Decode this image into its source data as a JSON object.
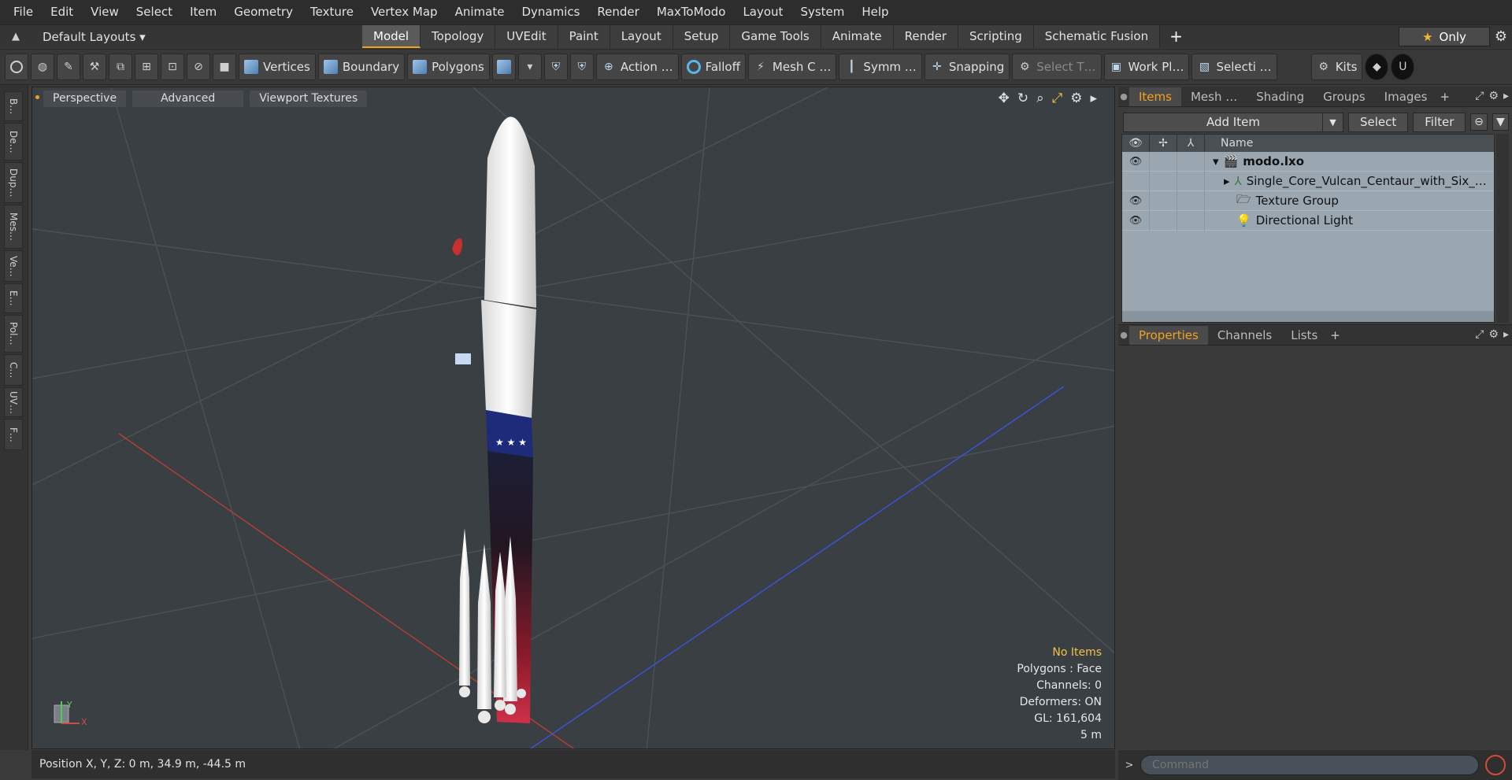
{
  "menubar": [
    "File",
    "Edit",
    "View",
    "Select",
    "Item",
    "Geometry",
    "Texture",
    "Vertex Map",
    "Animate",
    "Dynamics",
    "Render",
    "MaxToModo",
    "Layout",
    "System",
    "Help"
  ],
  "layoutbar": {
    "default_layouts": "Default Layouts ▾",
    "tabs": [
      "Model",
      "Topology",
      "UVEdit",
      "Paint",
      "Layout",
      "Setup",
      "Game Tools",
      "Animate",
      "Render",
      "Scripting",
      "Schematic Fusion"
    ],
    "active_tab": "Model",
    "add_tab": "+",
    "only_label": "Only"
  },
  "toolbar": {
    "vertices": "Vertices",
    "boundary": "Boundary",
    "polygons": "Polygons",
    "action": "Action …",
    "falloff": "Falloff",
    "mesh_c": "Mesh C …",
    "symm": "Symm …",
    "snapping": "Snapping",
    "select_t": "Select T…",
    "work_pl": "Work Pl…",
    "selecti": "Selecti …",
    "kits": "Kits"
  },
  "left_tabs": [
    "B…",
    "De…",
    "Dup…",
    "Mes…",
    "Ve…",
    "E…",
    "Pol…",
    "C…",
    "UV…",
    "F…"
  ],
  "viewport": {
    "perspective": "Perspective",
    "advanced": "Advanced",
    "viewport_textures": "Viewport Textures",
    "info": {
      "no_items": "No Items",
      "polygons": "Polygons : Face",
      "channels": "Channels: 0",
      "deformers": "Deformers: ON",
      "gl": "GL: 161,604",
      "scale": "5 m"
    },
    "axis": {
      "y": "Y",
      "x": "X"
    }
  },
  "statusbar": {
    "position": "Position X, Y, Z:   0 m, 34.9 m, -44.5 m"
  },
  "command": {
    "placeholder": "Command"
  },
  "items_panel": {
    "tabs": [
      "Items",
      "Mesh …",
      "Shading",
      "Groups",
      "Images"
    ],
    "active_tab": "Items",
    "add_item": "Add Item",
    "select": "Select",
    "filter": "Filter",
    "column_name": "Name",
    "rows": [
      {
        "name": "modo.lxo",
        "eye": true
      },
      {
        "name": "Single_Core_Vulcan_Centaur_with_Six_…",
        "eye": false
      },
      {
        "name": "Texture Group",
        "eye": true
      },
      {
        "name": "Directional Light",
        "eye": true
      }
    ]
  },
  "properties_panel": {
    "tabs": [
      "Properties",
      "Channels",
      "Lists"
    ],
    "active_tab": "Properties",
    "add": "+"
  },
  "colors": {
    "accent": "#f2a020",
    "viewport_bg": "#3a3f44",
    "axis_x": "#d04030",
    "axis_z": "#3050d8"
  }
}
